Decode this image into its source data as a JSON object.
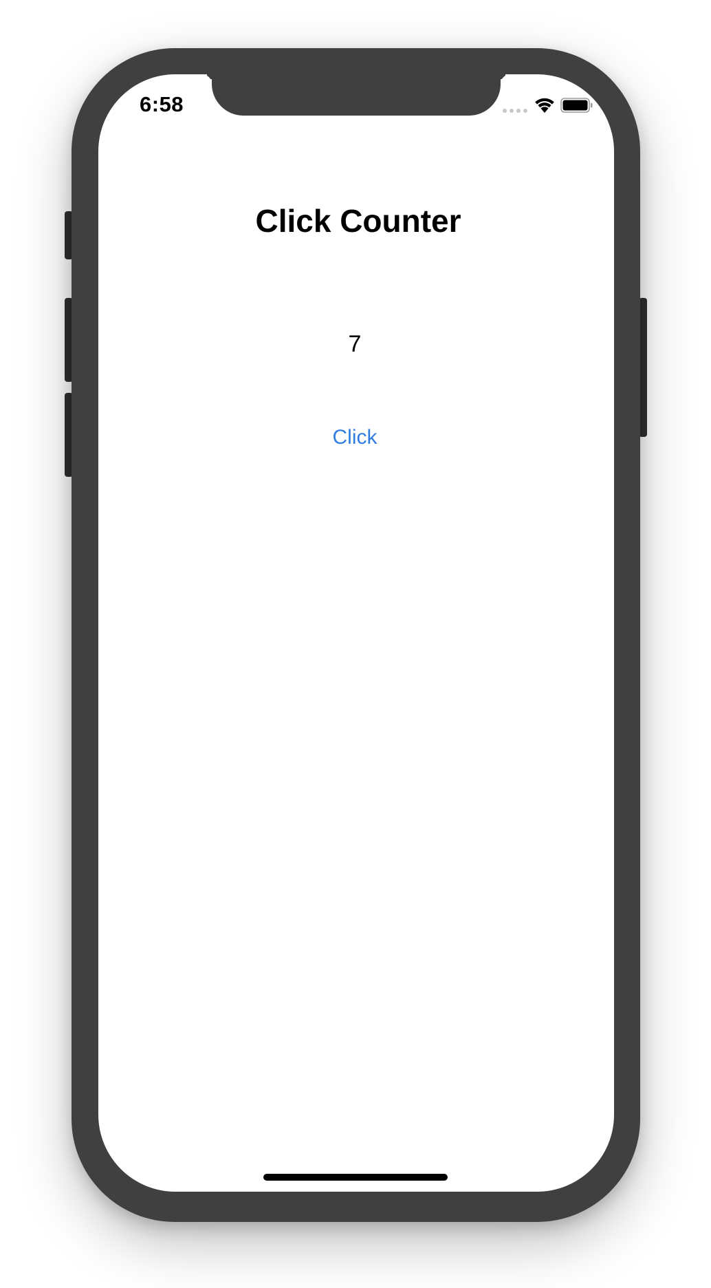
{
  "status_bar": {
    "time": "6:58",
    "wifi_icon": "wifi-icon",
    "battery_icon": "battery-icon",
    "signal_icon": "cellular-signal-icon"
  },
  "app": {
    "title": "Click Counter",
    "counter_value": "7",
    "button_label": "Click"
  },
  "colors": {
    "device_frame": "#404040",
    "screen_background": "#ffffff",
    "button_tint": "#2f7de1",
    "text": "#000000"
  }
}
